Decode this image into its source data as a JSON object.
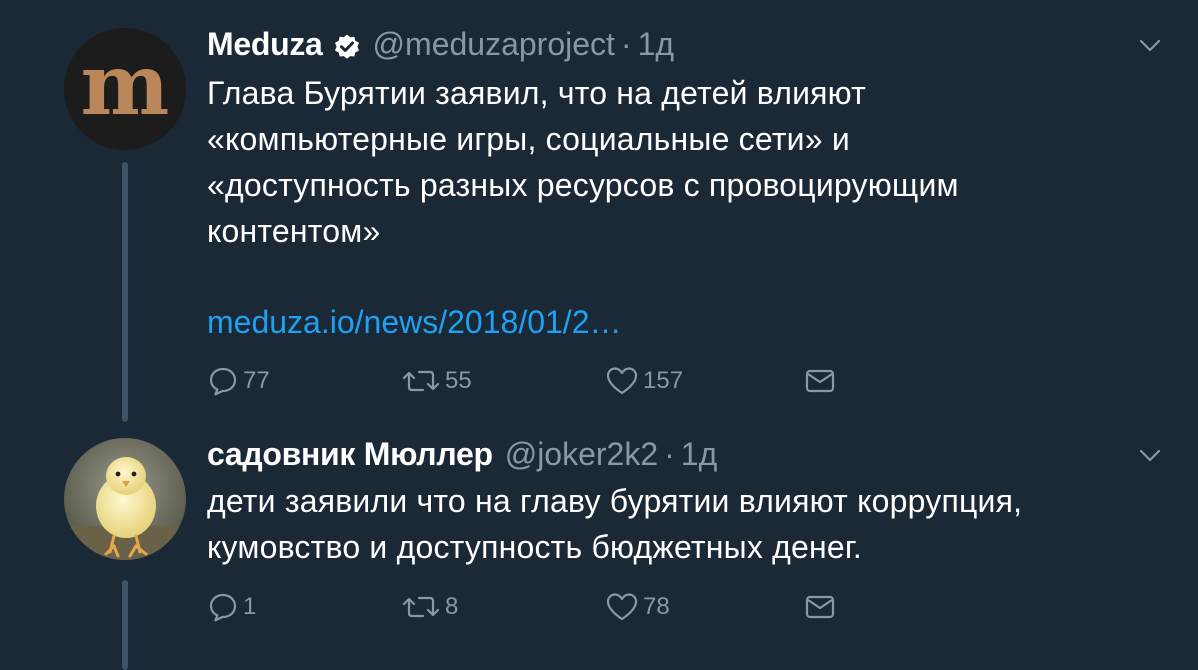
{
  "tweets": [
    {
      "name": "Meduza",
      "verified": true,
      "handle": "@meduzaproject",
      "separator": "·",
      "time": "1д",
      "text_lines": [
        "Глава Бурятии заявил, что на детей влияют",
        "«компьютерные игры, социальные сети» и",
        "«доступность разных ресурсов с провоцирующим",
        "контентом»"
      ],
      "link": "meduza.io/news/2018/01/2…",
      "avatar_letter": "m",
      "replies": "77",
      "retweets": "55",
      "likes": "157"
    },
    {
      "name": "садовник Мюллер",
      "verified": false,
      "handle": "@joker2k2",
      "separator": "·",
      "time": "1д",
      "text_lines": [
        "дети заявили что на главу бурятии влияют коррупция,",
        "кумовство и доступность бюджетных денег."
      ],
      "replies": "1",
      "retweets": "8",
      "likes": "78"
    }
  ],
  "colors": {
    "background": "#1b2836",
    "secondary_text": "#8899a6",
    "link": "#1da1f2",
    "thread_line": "#3d5466",
    "meduza_gold": "#b9875a"
  }
}
